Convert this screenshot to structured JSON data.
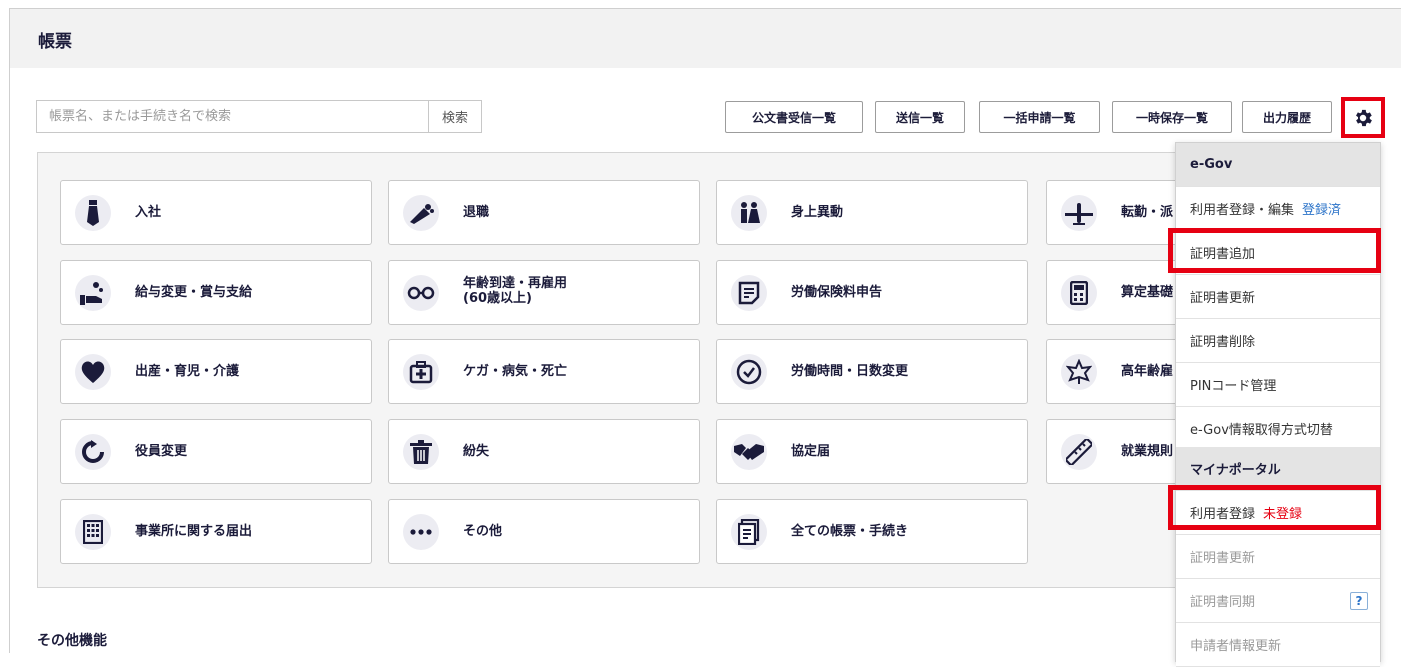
{
  "header": {
    "title": "帳票"
  },
  "search": {
    "placeholder": "帳票名、または手続き名で検索",
    "button": "検索"
  },
  "toolbar": {
    "buttons": [
      "公文書受信一覧",
      "送信一覧",
      "一括申請一覧",
      "一時保存一覧",
      "出力履歴"
    ]
  },
  "cards": [
    {
      "label": "入社",
      "icon": "tie-icon"
    },
    {
      "label": "退職",
      "icon": "bouquet-icon"
    },
    {
      "label": "身上異動",
      "icon": "couple-icon"
    },
    {
      "label": "転勤・派",
      "icon": "airplane-icon"
    },
    {
      "label": "給与変更・賞与支給",
      "icon": "salary-hand-icon"
    },
    {
      "label": "年齢到達・再雇用",
      "label2": "(60歳以上)",
      "icon": "glasses-icon"
    },
    {
      "label": "労働保険料申告",
      "icon": "document-icon"
    },
    {
      "label": "算定基礎",
      "icon": "calculator-icon"
    },
    {
      "label": "出産・育児・介護",
      "icon": "heart-icon"
    },
    {
      "label": "ケガ・病気・死亡",
      "icon": "medical-kit-icon"
    },
    {
      "label": "労働時間・日数変更",
      "icon": "clock-icon"
    },
    {
      "label": "高年齢雇",
      "icon": "maple-leaf-icon"
    },
    {
      "label": "役員変更",
      "icon": "refresh-icon"
    },
    {
      "label": "紛失",
      "icon": "trash-icon"
    },
    {
      "label": "協定届",
      "icon": "handshake-icon"
    },
    {
      "label": "就業規則",
      "icon": "ruler-icon"
    },
    {
      "label": "事業所に関する届出",
      "icon": "building-icon"
    },
    {
      "label": "その他",
      "icon": "more-icon"
    },
    {
      "label": "全ての帳票・手続き",
      "icon": "documents-icon"
    }
  ],
  "other": {
    "title": "その他機能"
  },
  "menu": {
    "egov_header": "e-Gov",
    "egov_items": [
      {
        "label": "利用者登録・編集",
        "status": "登録済"
      },
      {
        "label": "証明書追加"
      },
      {
        "label": "証明書更新"
      },
      {
        "label": "証明書削除"
      },
      {
        "label": "PINコード管理"
      },
      {
        "label": "e-Gov情報取得方式切替"
      }
    ],
    "mynaportal_header": "マイナポータル",
    "mynaportal_items": [
      {
        "label": "利用者登録",
        "status": "未登録"
      },
      {
        "label": "証明書更新"
      },
      {
        "label": "証明書同期",
        "help": "?"
      },
      {
        "label": "申請者情報更新"
      }
    ]
  },
  "colors": {
    "accent_red": "#e60012",
    "navy": "#1b1b3a",
    "link_blue": "#2c74c9"
  }
}
